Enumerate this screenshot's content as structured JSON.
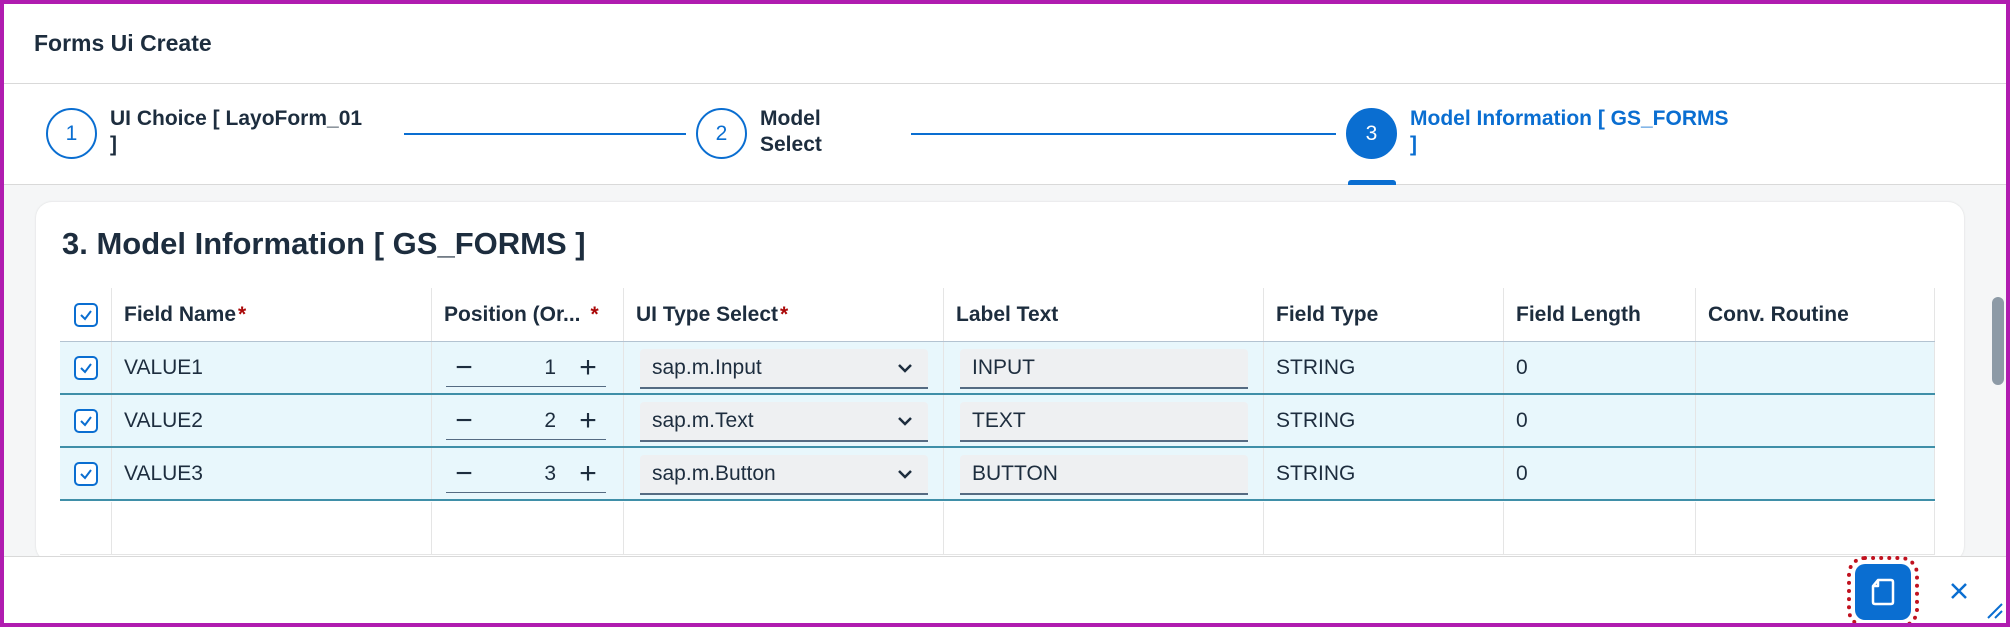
{
  "dialog": {
    "title": "Forms Ui Create"
  },
  "stepper": {
    "steps": [
      {
        "number": "1",
        "line1": "UI Choice [ LayoForm_01",
        "line2": "]"
      },
      {
        "number": "2",
        "line1": "Model",
        "line2": "Select"
      },
      {
        "number": "3",
        "line1": "Model Information [ GS_FORMS",
        "line2": "]"
      }
    ],
    "active_step": 3
  },
  "section": {
    "title": "3. Model Information [ GS_FORMS ]"
  },
  "table": {
    "columns": [
      {
        "label": "Field Name",
        "required": "*"
      },
      {
        "label": "Position (Or...",
        "required": "*"
      },
      {
        "label": "UI Type Select",
        "required": "*"
      },
      {
        "label": "Label Text",
        "required": ""
      },
      {
        "label": "Field Type",
        "required": ""
      },
      {
        "label": "Field Length",
        "required": ""
      },
      {
        "label": "Conv. Routine",
        "required": ""
      }
    ],
    "rows": [
      {
        "selected": true,
        "field_name": "VALUE1",
        "position": "1",
        "ui_type": "sap.m.Input",
        "label_text": "INPUT",
        "field_type": "STRING",
        "field_length": "0",
        "conv_routine": ""
      },
      {
        "selected": true,
        "field_name": "VALUE2",
        "position": "2",
        "ui_type": "sap.m.Text",
        "label_text": "TEXT",
        "field_type": "STRING",
        "field_length": "0",
        "conv_routine": ""
      },
      {
        "selected": true,
        "field_name": "VALUE3",
        "position": "3",
        "ui_type": "sap.m.Button",
        "label_text": "BUTTON",
        "field_type": "STRING",
        "field_length": "0",
        "conv_routine": ""
      }
    ]
  },
  "colors": {
    "accent": "#0a6ed1",
    "frame_border": "#b01cb0",
    "selected_row": "#e8f7fc",
    "required": "#aa0808"
  },
  "icons": {
    "checkbox": "check-icon",
    "minus": "minus-icon",
    "plus": "plus-icon",
    "dropdown": "chevron-down-icon",
    "copy": "copy-icon",
    "close": "close-icon",
    "resize": "resize-handle-icon"
  }
}
